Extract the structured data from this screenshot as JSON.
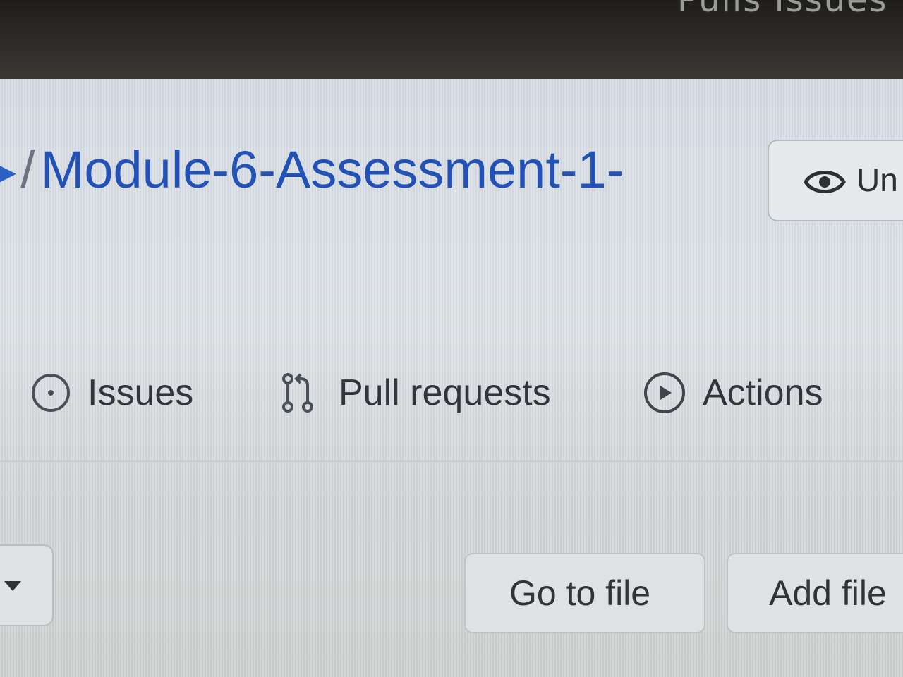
{
  "top_bar": {
    "partial_text": "Pulls  Issues"
  },
  "repo_header": {
    "separator": "/",
    "name": "Module-6-Assessment-1-"
  },
  "watch_button": {
    "label": "Un"
  },
  "tabs": [
    {
      "label": "Issues",
      "icon": "issue-opened-icon"
    },
    {
      "label": "Pull requests",
      "icon": "git-pull-request-icon"
    },
    {
      "label": "Actions",
      "icon": "play-icon"
    }
  ],
  "file_toolbar": {
    "go_to_file": "Go to file",
    "add_file": "Add file"
  },
  "colors": {
    "link_blue": "#2252b8",
    "text_gray": "#2f353b",
    "border": "#bfc3c6"
  }
}
